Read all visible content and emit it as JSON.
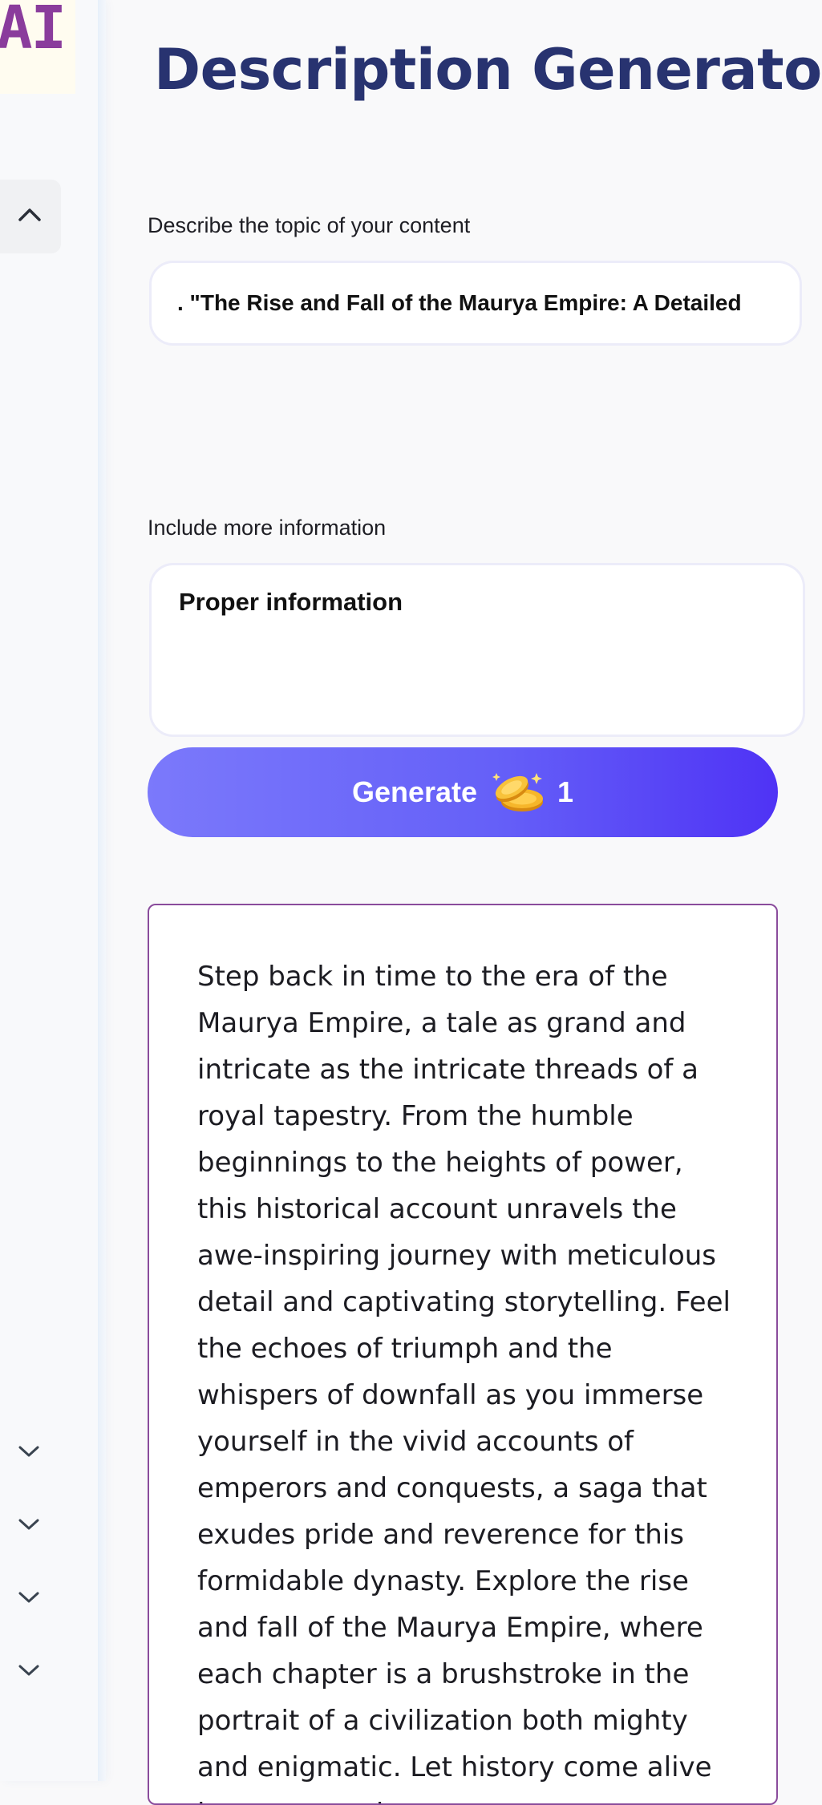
{
  "logo": {
    "text": "AI"
  },
  "sidebar": {
    "collapse_icon": "chevron-up-icon",
    "nav_icons": [
      "chevron-down-icon",
      "chevron-down-icon",
      "chevron-down-icon",
      "chevron-down-icon"
    ]
  },
  "page": {
    "title": "Description Generator"
  },
  "form": {
    "topic_label": "Describe the topic of your content",
    "topic_value": ". \"The Rise and Fall of the Maurya Empire: A Detailed",
    "info_label": "Include more information",
    "info_value": "Proper information",
    "generate_label": "Generate",
    "generate_cost": "1",
    "generate_icon": "coins-icon"
  },
  "output": {
    "text": "Step back in time to the era of the Maurya Empire, a tale as grand and intricate as the intricate threads of a royal tapestry. From the humble beginnings to the heights of power, this historical account unravels the awe-inspiring journey with meticulous detail and captivating storytelling. Feel the echoes of triumph and the whispers of downfall as you immerse yourself in the vivid accounts of emperors and conquests, a saga that exudes pride and reverence for this formidable dynasty. Explore the rise and fall of the Maurya Empire, where each chapter is a brushstroke in the portrait of a civilization both mighty and enigmatic. Let history come alive in every word,"
  },
  "colors": {
    "title": "#283370",
    "accent_start": "#7b79fb",
    "accent_end": "#4f33f5",
    "logo": "#8a3c9c",
    "output_border": "#8a4c9c"
  }
}
